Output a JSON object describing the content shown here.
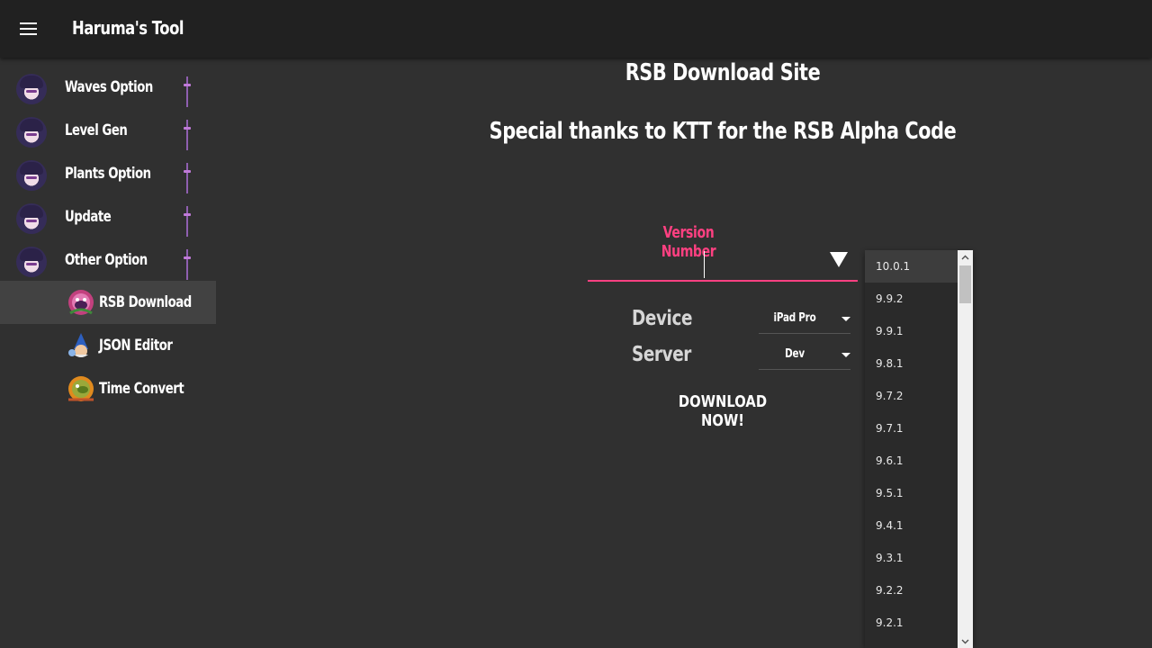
{
  "app": {
    "title": "Haruma's Tool",
    "menu_icon": "hamburger-menu-icon"
  },
  "sidebar": {
    "items": [
      {
        "label": "Waves Option",
        "icon": "character-avatar-icon"
      },
      {
        "label": "Level Gen",
        "icon": "character-avatar-icon"
      },
      {
        "label": "Plants Option",
        "icon": "character-avatar-icon"
      },
      {
        "label": "Update",
        "icon": "character-avatar-icon"
      },
      {
        "label": "Other Option",
        "icon": "character-avatar-icon"
      }
    ],
    "sub_items": [
      {
        "label": "RSB Download",
        "icon": "plant-monster-icon",
        "active": true
      },
      {
        "label": "JSON Editor",
        "icon": "wizard-gnome-icon",
        "active": false
      },
      {
        "label": "Time Convert",
        "icon": "sun-plant-icon",
        "active": false
      }
    ],
    "active_color": "#424242"
  },
  "main": {
    "heading": "RSB Download Site",
    "subheading": "Special thanks to KTT for the RSB Alpha Code",
    "version_field": {
      "label": "Version Number",
      "value": "",
      "accent_color": "#ff4081"
    },
    "device": {
      "label": "Device",
      "value": "iPad Pro"
    },
    "server": {
      "label": "Server",
      "value": "Dev"
    },
    "download_button": "DOWNLOAD NOW!"
  },
  "version_list": {
    "options": [
      "10.0.1",
      "9.9.2",
      "9.9.1",
      "9.8.1",
      "9.7.2",
      "9.7.1",
      "9.6.1",
      "9.5.1",
      "9.4.1",
      "9.3.1",
      "9.2.2",
      "9.2.1"
    ],
    "highlighted": "10.0.1"
  }
}
